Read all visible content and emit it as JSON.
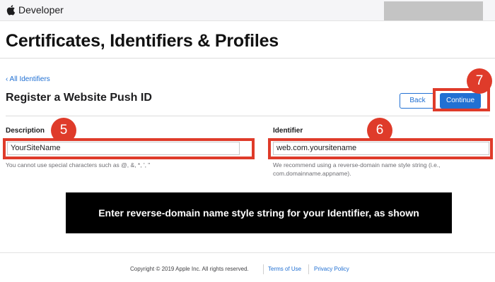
{
  "header": {
    "brand_text": "Developer",
    "brand_icon": "apple-icon"
  },
  "page": {
    "title": "Certificates, Identifiers & Profiles",
    "back_link": "‹ All Identifiers",
    "section_title": "Register a Website Push ID"
  },
  "buttons": {
    "back_label": "Back",
    "continue_label": "Continue"
  },
  "form": {
    "description": {
      "label": "Description",
      "value": "YourSiteName",
      "hint": "You cannot use special characters such as @, &, *, ', \""
    },
    "identifier": {
      "label": "Identifier",
      "value": "web.com.yoursitename",
      "hint_line1": "We recommend using a reverse-domain name style string (i.e.,",
      "hint_line2": "com.domainname.appname)."
    }
  },
  "annotations": {
    "step_description": "5",
    "step_identifier": "6",
    "step_continue": "7",
    "highlight_color": "#df3b2a",
    "banner_text": "Enter reverse-domain name style string for your Identifier, as shown"
  },
  "footer": {
    "copyright": "Copyright © 2019 Apple Inc. All rights reserved.",
    "terms_label": "Terms of Use",
    "privacy_label": "Privacy Policy"
  },
  "colors": {
    "accent": "#2170d3",
    "annotation": "#df3b2a"
  }
}
